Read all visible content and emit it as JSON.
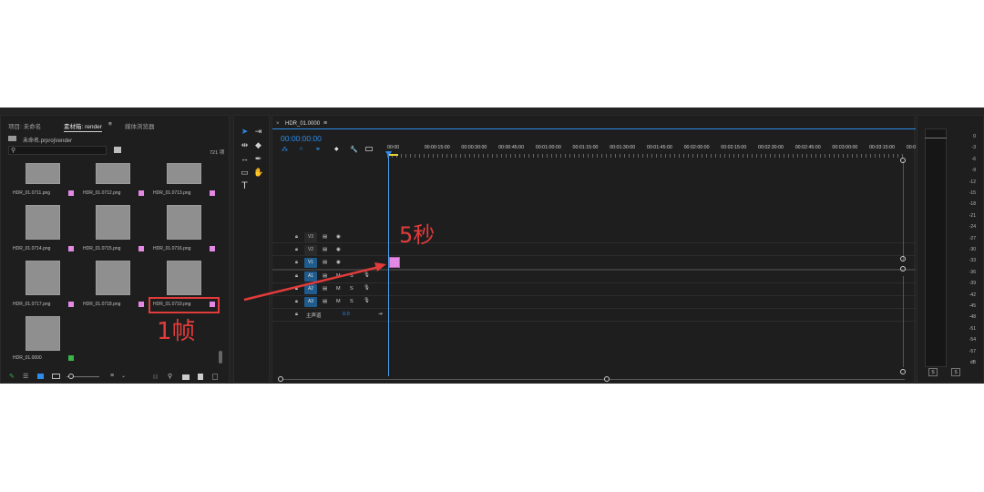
{
  "project": {
    "tabs": [
      "项目: 未命名",
      "素材箱: render",
      "媒体浏览器"
    ],
    "active_tab_index": 1,
    "path": "未命名.prproj\\render",
    "search_placeholder": "",
    "item_count": "721 项",
    "items": [
      {
        "label": "HDR_01.0711.png",
        "badge": "pink"
      },
      {
        "label": "HDR_01.0712.png",
        "badge": "pink"
      },
      {
        "label": "HDR_01.0713.png",
        "badge": "pink"
      },
      {
        "label": "HDR_01.0714.png",
        "badge": "pink"
      },
      {
        "label": "HDR_01.0715.png",
        "badge": "pink"
      },
      {
        "label": "HDR_01.0716.png",
        "badge": "pink"
      },
      {
        "label": "HDR_01.0717.png",
        "badge": "pink"
      },
      {
        "label": "HDR_01.0718.png",
        "badge": "pink"
      },
      {
        "label": "HDR_01.0719.png",
        "badge": "pink"
      },
      {
        "label": "HDR_01.0000",
        "badge": "green"
      }
    ]
  },
  "timeline": {
    "sequence_name": "HDR_01.0000",
    "timecode": "00:00:00:00",
    "ruler": [
      "00:00",
      "00:00:15:00",
      "00:00:30:00",
      "00:00:45:00",
      "00:01:00:00",
      "00:01:15:00",
      "00:01:30:00",
      "00:01:45:00",
      "00:02:00:00",
      "00:02:15:00",
      "00:02:30:00",
      "00:02:45:00",
      "00:03:00:00",
      "00:03:15:00",
      "00:0"
    ],
    "video_tracks": [
      "V3",
      "V2",
      "V1"
    ],
    "audio_tracks": [
      "A1",
      "A2",
      "A3"
    ],
    "master_label": "主声道",
    "master_value": "0.0",
    "m_label": "M",
    "s_label": "S"
  },
  "meter": {
    "scale": [
      "0",
      "-3",
      "-6",
      "-9",
      "-12",
      "-15",
      "-18",
      "-21",
      "-24",
      "-27",
      "-30",
      "-33",
      "-36",
      "-39",
      "-42",
      "-45",
      "-48",
      "-51",
      "-54",
      "-57",
      "dB"
    ],
    "solo_labels": [
      "S",
      "S"
    ]
  },
  "annotations": {
    "duration_label": "5秒",
    "frame_label": "1帧"
  },
  "colors": {
    "accent_blue": "#2d8ceb",
    "clip_pink": "#e389e3",
    "annotation_red": "#e23b3b"
  }
}
